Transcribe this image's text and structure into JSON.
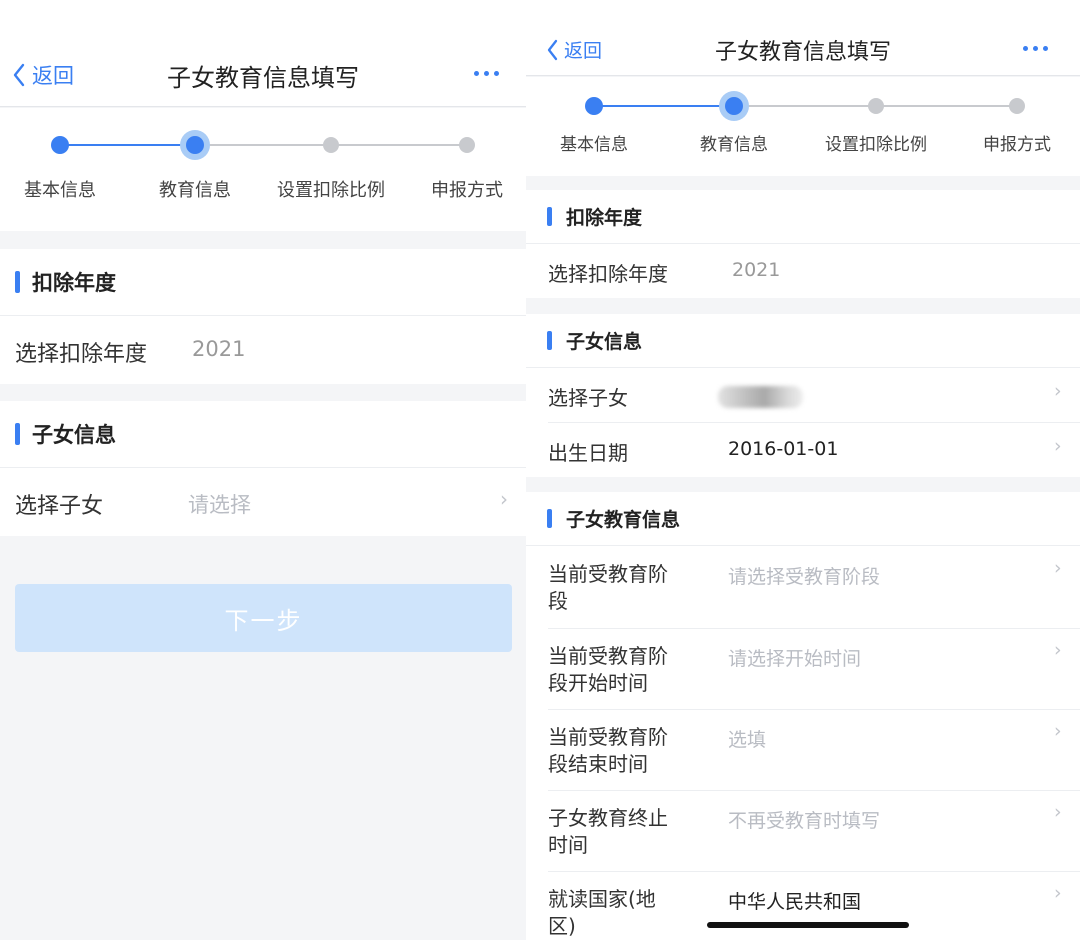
{
  "colors": {
    "accent": "#3a7ff2",
    "step_inactive": "#c8cace",
    "placeholder": "#b9bcc3",
    "button_disabled": "#cfe4fb"
  },
  "left": {
    "header": {
      "back_label": "返回",
      "title": "子女教育信息填写"
    },
    "steps": [
      "基本信息",
      "教育信息",
      "设置扣除比例",
      "申报方式"
    ],
    "current_step": 2,
    "year_section": {
      "title": "扣除年度",
      "label": "选择扣除年度",
      "value": "2021"
    },
    "child_section": {
      "title": "子女信息",
      "label": "选择子女",
      "placeholder": "请选择"
    },
    "next_button": "下一步"
  },
  "right": {
    "header": {
      "back_label": "返回",
      "title": "子女教育信息填写"
    },
    "steps": [
      "基本信息",
      "教育信息",
      "设置扣除比例",
      "申报方式"
    ],
    "current_step": 2,
    "year_section": {
      "title": "扣除年度",
      "label": "选择扣除年度",
      "value": "2021"
    },
    "child_section": {
      "title": "子女信息",
      "select_label": "选择子女",
      "birth_label": "出生日期",
      "birth_value": "2016-01-01"
    },
    "edu_section": {
      "title": "子女教育信息",
      "rows": [
        {
          "label_1": "当前受教育阶",
          "label_2": "段",
          "value": "请选择受教育阶段",
          "kind": "placeholder"
        },
        {
          "label_1": "当前受教育阶",
          "label_2": "段开始时间",
          "value": "请选择开始时间",
          "kind": "placeholder"
        },
        {
          "label_1": "当前受教育阶",
          "label_2": "段结束时间",
          "value": "选填",
          "kind": "placeholder"
        },
        {
          "label_1": "子女教育终止",
          "label_2": "时间",
          "value": "不再受教育时填写",
          "kind": "placeholder"
        },
        {
          "label_1": "就读国家(地",
          "label_2": "区)",
          "value": "中华人民共和国",
          "kind": "value"
        }
      ]
    }
  }
}
